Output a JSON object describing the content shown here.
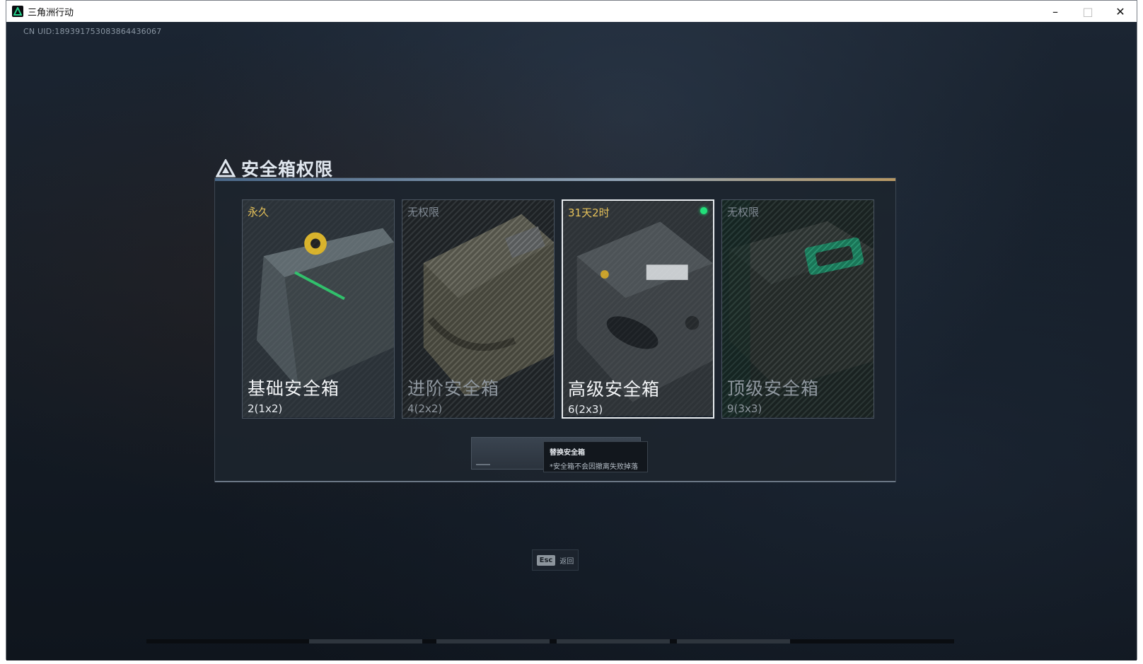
{
  "window": {
    "title": "三角洲行动",
    "controls": {
      "minimize": "–",
      "maximize": "□",
      "close": "✕"
    }
  },
  "uid_text": "CN UID:189391753083864436067",
  "panel": {
    "title": "安全箱权限",
    "cards": [
      {
        "status": "永久",
        "name": "基础安全箱",
        "size": "2(1x2)",
        "locked": false,
        "selected": false
      },
      {
        "status": "无权限",
        "name": "进阶安全箱",
        "size": "4(2x2)",
        "locked": true,
        "selected": false
      },
      {
        "status": "31天2时",
        "name": "高级安全箱",
        "size": "6(2x3)",
        "locked": false,
        "selected": true
      },
      {
        "status": "无权限",
        "name": "顶级安全箱",
        "size": "9(3x3)",
        "locked": true,
        "selected": false
      }
    ],
    "replace_button": {
      "tooltip_title": "替换安全箱",
      "tooltip_note": "*安全箱不会因撤离失败掉落"
    }
  },
  "esc_hint": {
    "key": "Esc",
    "label": "返回"
  },
  "colors": {
    "status_active": "#e6c25a",
    "status_locked": "#7f8892",
    "equipped_dot": "#22e07a",
    "selected_border": "#e8ecef"
  }
}
